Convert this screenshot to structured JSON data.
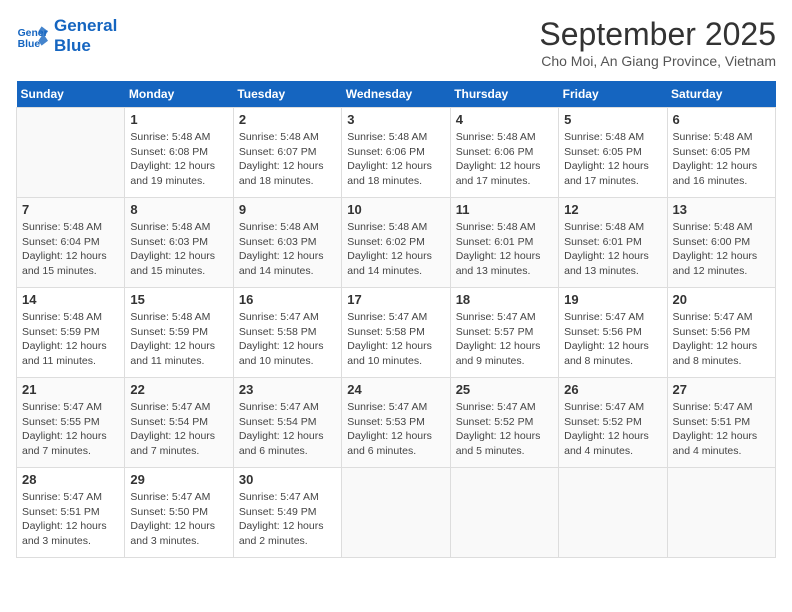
{
  "header": {
    "logo_line1": "General",
    "logo_line2": "Blue",
    "month_title": "September 2025",
    "subtitle": "Cho Moi, An Giang Province, Vietnam"
  },
  "days_of_week": [
    "Sunday",
    "Monday",
    "Tuesday",
    "Wednesday",
    "Thursday",
    "Friday",
    "Saturday"
  ],
  "weeks": [
    [
      {
        "day": "",
        "info": ""
      },
      {
        "day": "1",
        "info": "Sunrise: 5:48 AM\nSunset: 6:08 PM\nDaylight: 12 hours\nand 19 minutes."
      },
      {
        "day": "2",
        "info": "Sunrise: 5:48 AM\nSunset: 6:07 PM\nDaylight: 12 hours\nand 18 minutes."
      },
      {
        "day": "3",
        "info": "Sunrise: 5:48 AM\nSunset: 6:06 PM\nDaylight: 12 hours\nand 18 minutes."
      },
      {
        "day": "4",
        "info": "Sunrise: 5:48 AM\nSunset: 6:06 PM\nDaylight: 12 hours\nand 17 minutes."
      },
      {
        "day": "5",
        "info": "Sunrise: 5:48 AM\nSunset: 6:05 PM\nDaylight: 12 hours\nand 17 minutes."
      },
      {
        "day": "6",
        "info": "Sunrise: 5:48 AM\nSunset: 6:05 PM\nDaylight: 12 hours\nand 16 minutes."
      }
    ],
    [
      {
        "day": "7",
        "info": "Sunrise: 5:48 AM\nSunset: 6:04 PM\nDaylight: 12 hours\nand 15 minutes."
      },
      {
        "day": "8",
        "info": "Sunrise: 5:48 AM\nSunset: 6:03 PM\nDaylight: 12 hours\nand 15 minutes."
      },
      {
        "day": "9",
        "info": "Sunrise: 5:48 AM\nSunset: 6:03 PM\nDaylight: 12 hours\nand 14 minutes."
      },
      {
        "day": "10",
        "info": "Sunrise: 5:48 AM\nSunset: 6:02 PM\nDaylight: 12 hours\nand 14 minutes."
      },
      {
        "day": "11",
        "info": "Sunrise: 5:48 AM\nSunset: 6:01 PM\nDaylight: 12 hours\nand 13 minutes."
      },
      {
        "day": "12",
        "info": "Sunrise: 5:48 AM\nSunset: 6:01 PM\nDaylight: 12 hours\nand 13 minutes."
      },
      {
        "day": "13",
        "info": "Sunrise: 5:48 AM\nSunset: 6:00 PM\nDaylight: 12 hours\nand 12 minutes."
      }
    ],
    [
      {
        "day": "14",
        "info": "Sunrise: 5:48 AM\nSunset: 5:59 PM\nDaylight: 12 hours\nand 11 minutes."
      },
      {
        "day": "15",
        "info": "Sunrise: 5:48 AM\nSunset: 5:59 PM\nDaylight: 12 hours\nand 11 minutes."
      },
      {
        "day": "16",
        "info": "Sunrise: 5:47 AM\nSunset: 5:58 PM\nDaylight: 12 hours\nand 10 minutes."
      },
      {
        "day": "17",
        "info": "Sunrise: 5:47 AM\nSunset: 5:58 PM\nDaylight: 12 hours\nand 10 minutes."
      },
      {
        "day": "18",
        "info": "Sunrise: 5:47 AM\nSunset: 5:57 PM\nDaylight: 12 hours\nand 9 minutes."
      },
      {
        "day": "19",
        "info": "Sunrise: 5:47 AM\nSunset: 5:56 PM\nDaylight: 12 hours\nand 8 minutes."
      },
      {
        "day": "20",
        "info": "Sunrise: 5:47 AM\nSunset: 5:56 PM\nDaylight: 12 hours\nand 8 minutes."
      }
    ],
    [
      {
        "day": "21",
        "info": "Sunrise: 5:47 AM\nSunset: 5:55 PM\nDaylight: 12 hours\nand 7 minutes."
      },
      {
        "day": "22",
        "info": "Sunrise: 5:47 AM\nSunset: 5:54 PM\nDaylight: 12 hours\nand 7 minutes."
      },
      {
        "day": "23",
        "info": "Sunrise: 5:47 AM\nSunset: 5:54 PM\nDaylight: 12 hours\nand 6 minutes."
      },
      {
        "day": "24",
        "info": "Sunrise: 5:47 AM\nSunset: 5:53 PM\nDaylight: 12 hours\nand 6 minutes."
      },
      {
        "day": "25",
        "info": "Sunrise: 5:47 AM\nSunset: 5:52 PM\nDaylight: 12 hours\nand 5 minutes."
      },
      {
        "day": "26",
        "info": "Sunrise: 5:47 AM\nSunset: 5:52 PM\nDaylight: 12 hours\nand 4 minutes."
      },
      {
        "day": "27",
        "info": "Sunrise: 5:47 AM\nSunset: 5:51 PM\nDaylight: 12 hours\nand 4 minutes."
      }
    ],
    [
      {
        "day": "28",
        "info": "Sunrise: 5:47 AM\nSunset: 5:51 PM\nDaylight: 12 hours\nand 3 minutes."
      },
      {
        "day": "29",
        "info": "Sunrise: 5:47 AM\nSunset: 5:50 PM\nDaylight: 12 hours\nand 3 minutes."
      },
      {
        "day": "30",
        "info": "Sunrise: 5:47 AM\nSunset: 5:49 PM\nDaylight: 12 hours\nand 2 minutes."
      },
      {
        "day": "",
        "info": ""
      },
      {
        "day": "",
        "info": ""
      },
      {
        "day": "",
        "info": ""
      },
      {
        "day": "",
        "info": ""
      }
    ]
  ]
}
